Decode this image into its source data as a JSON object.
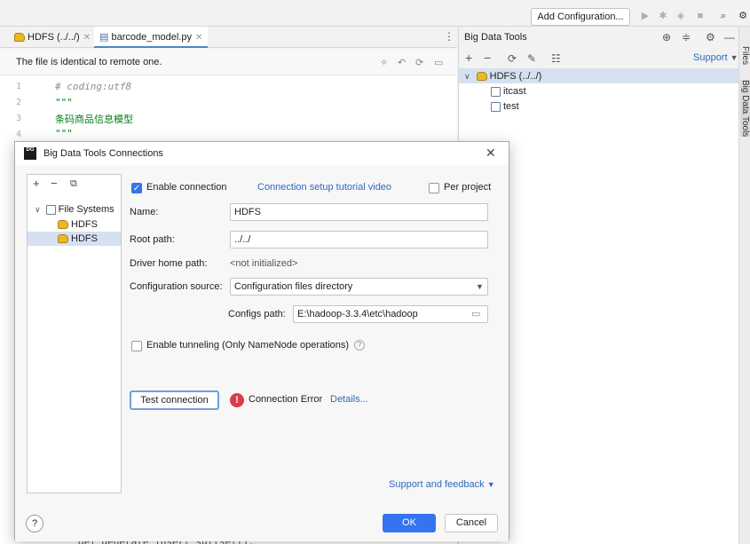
{
  "toolbar": {
    "add_config_label": "Add Configuration..."
  },
  "editor": {
    "tabs": [
      {
        "label": "HDFS (../../)"
      },
      {
        "label": "barcode_model.py"
      }
    ],
    "notice": "The file is identical to remote one.",
    "lines": [
      {
        "num": "1",
        "text": "# coding:utf8"
      },
      {
        "num": "2",
        "text": "\"\"\""
      },
      {
        "num": "3",
        "text": "条码商品信息模型"
      },
      {
        "num": "4",
        "text": "\"\"\""
      }
    ],
    "bottom_partial_text": "def generate_insert_sql(self):"
  },
  "right_panel": {
    "title": "Big Data Tools",
    "support_label": "Support",
    "tree": {
      "root": "HDFS (../../)",
      "children": [
        "itcast",
        "test"
      ]
    },
    "stripe_files": "Files",
    "stripe_tools": "Big Data Tools"
  },
  "dialog": {
    "title": "Big Data Tools Connections",
    "logo_text": "DG",
    "tree": {
      "group": "File Systems",
      "items": [
        "HDFS",
        "HDFS"
      ]
    },
    "enable_connection": "Enable connection",
    "tutorial_link": "Connection setup tutorial video",
    "per_project": "Per project",
    "name_label": "Name:",
    "name_value": "HDFS",
    "root_label": "Root path:",
    "root_value": "../../",
    "driver_label": "Driver home path:",
    "driver_value": "<not initialized>",
    "config_source_label": "Configuration source:",
    "config_source_value": "Configuration files directory",
    "configs_path_label": "Configs path:",
    "configs_path_value": "E:\\hadoop-3.3.4\\etc\\hadoop",
    "tunneling_label": "Enable tunneling (Only NameNode operations)",
    "test_button": "Test connection",
    "error_text": "Connection Error",
    "details_link": "Details...",
    "support_feedback": "Support and feedback",
    "help_label": "?",
    "ok_label": "OK",
    "cancel_label": "Cancel"
  },
  "colors": {
    "accent": "#3574f0",
    "error": "#db3b4b",
    "link": "#2f6ac0",
    "selection": "#d5e1f1"
  }
}
